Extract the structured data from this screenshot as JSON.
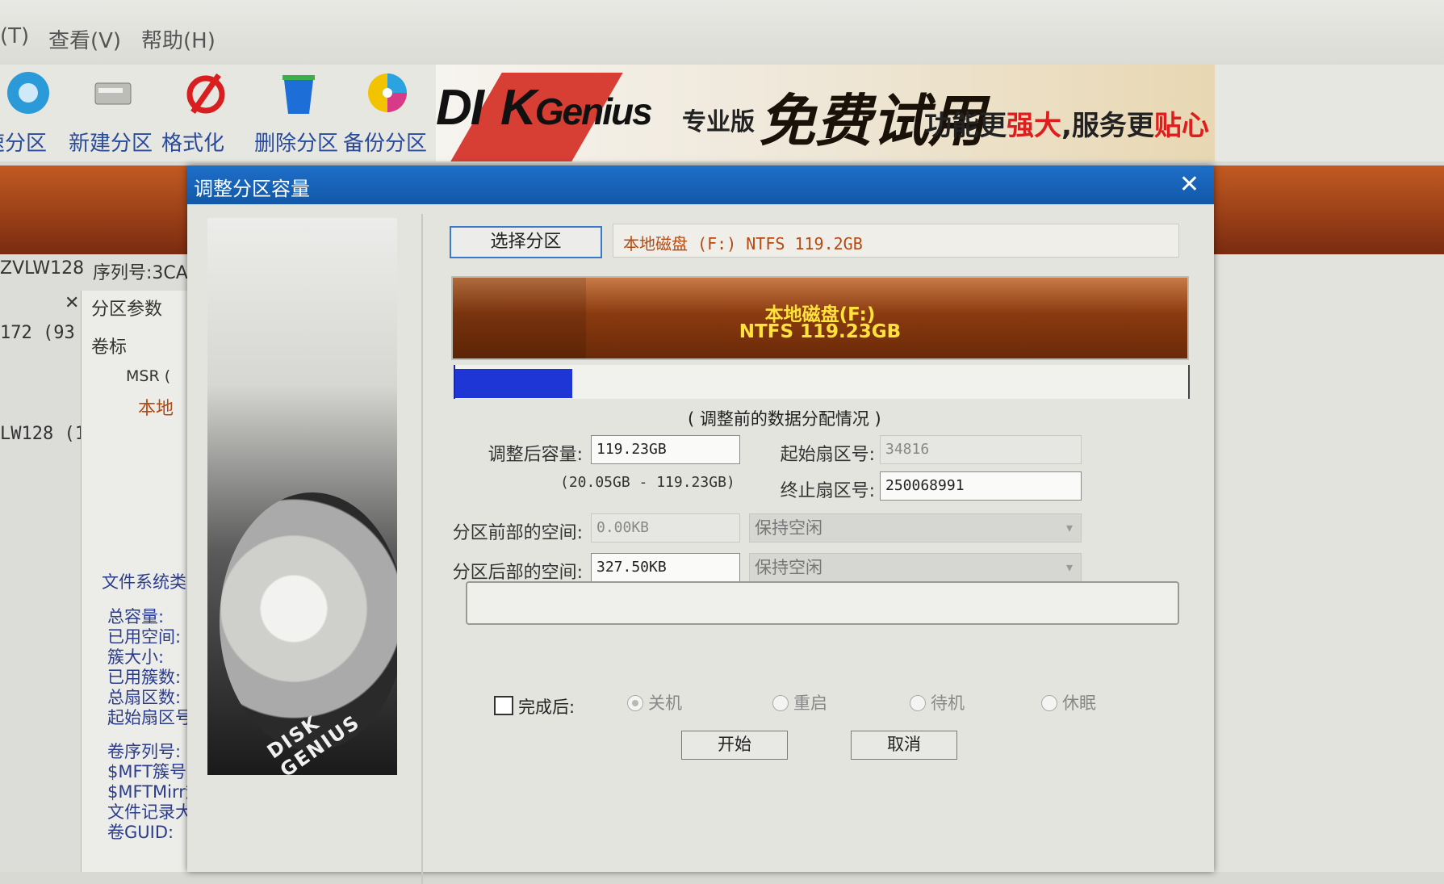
{
  "menu": [
    "(T)",
    "查看(V)",
    "帮助(H)"
  ],
  "toolbar": {
    "buttons": [
      {
        "label": "速分区",
        "icon": "quick-partition-icon"
      },
      {
        "label": "新建分区",
        "icon": "new-partition-icon"
      },
      {
        "label": "格式化",
        "icon": "format-icon"
      },
      {
        "label": "删除分区",
        "icon": "delete-partition-icon"
      },
      {
        "label": "备份分区",
        "icon": "backup-partition-icon"
      }
    ]
  },
  "banner": {
    "logo_a": "DI",
    "logo_b": "K",
    "logo_c": "Genius",
    "edition": "专业版",
    "promo": "免费试用",
    "slogan_1": "功能更",
    "slogan_2": "强大",
    "slogan_3": ",服务更",
    "slogan_4": "贴心"
  },
  "left_panel": {
    "disk_id": "ZVLW128",
    "serial_label": "序列号:3CA",
    "tree_a": "172 (93",
    "tree_b": "LW128 (1",
    "tab": "分区参数",
    "col_label": "卷标",
    "item_msr": "MSR (",
    "item_local": "本地",
    "fs_type": "文件系统类",
    "props": [
      "总容量:",
      "已用空间:",
      "簇大小:",
      "已用簇数:",
      "总扇区数:",
      "起始扇区号:"
    ],
    "props2": [
      "卷序列号:",
      "$MFT簇号:",
      "$MFTMirr簇",
      "文件记录大",
      "卷GUID:"
    ]
  },
  "dialog": {
    "title": "调整分区容量",
    "close": "✕",
    "select_button": "选择分区",
    "selected_info": "本地磁盘 (F:) NTFS 119.2GB",
    "partition_name": "本地磁盘(F:)",
    "partition_detail": "NTFS 119.23GB",
    "usage_fraction": 0.16,
    "caption": "( 调整前的数据分配情况 )",
    "size_label": "调整后容量:",
    "size_value": "119.23GB",
    "size_range": "(20.05GB - 119.23GB)",
    "start_label": "起始扇区号:",
    "start_value": "34816",
    "end_label": "终止扇区号:",
    "end_value": "250068991",
    "before_label": "分区前部的空间:",
    "before_value": "0.00KB",
    "before_option": "保持空闲",
    "after_label": "分区后部的空间:",
    "after_value": "327.50KB",
    "after_option": "保持空闲",
    "side_brand": "DISK GENIUS",
    "when_done_label": "完成后:",
    "radios": [
      "关机",
      "重启",
      "待机",
      "休眠"
    ],
    "start_button": "开始",
    "cancel_button": "取消"
  },
  "colors": {
    "title_bar": "#1e6ec8",
    "partition_bar": "#8a3a10",
    "partition_text": "#ffe23a",
    "usage_fill": "#1f36d6"
  }
}
